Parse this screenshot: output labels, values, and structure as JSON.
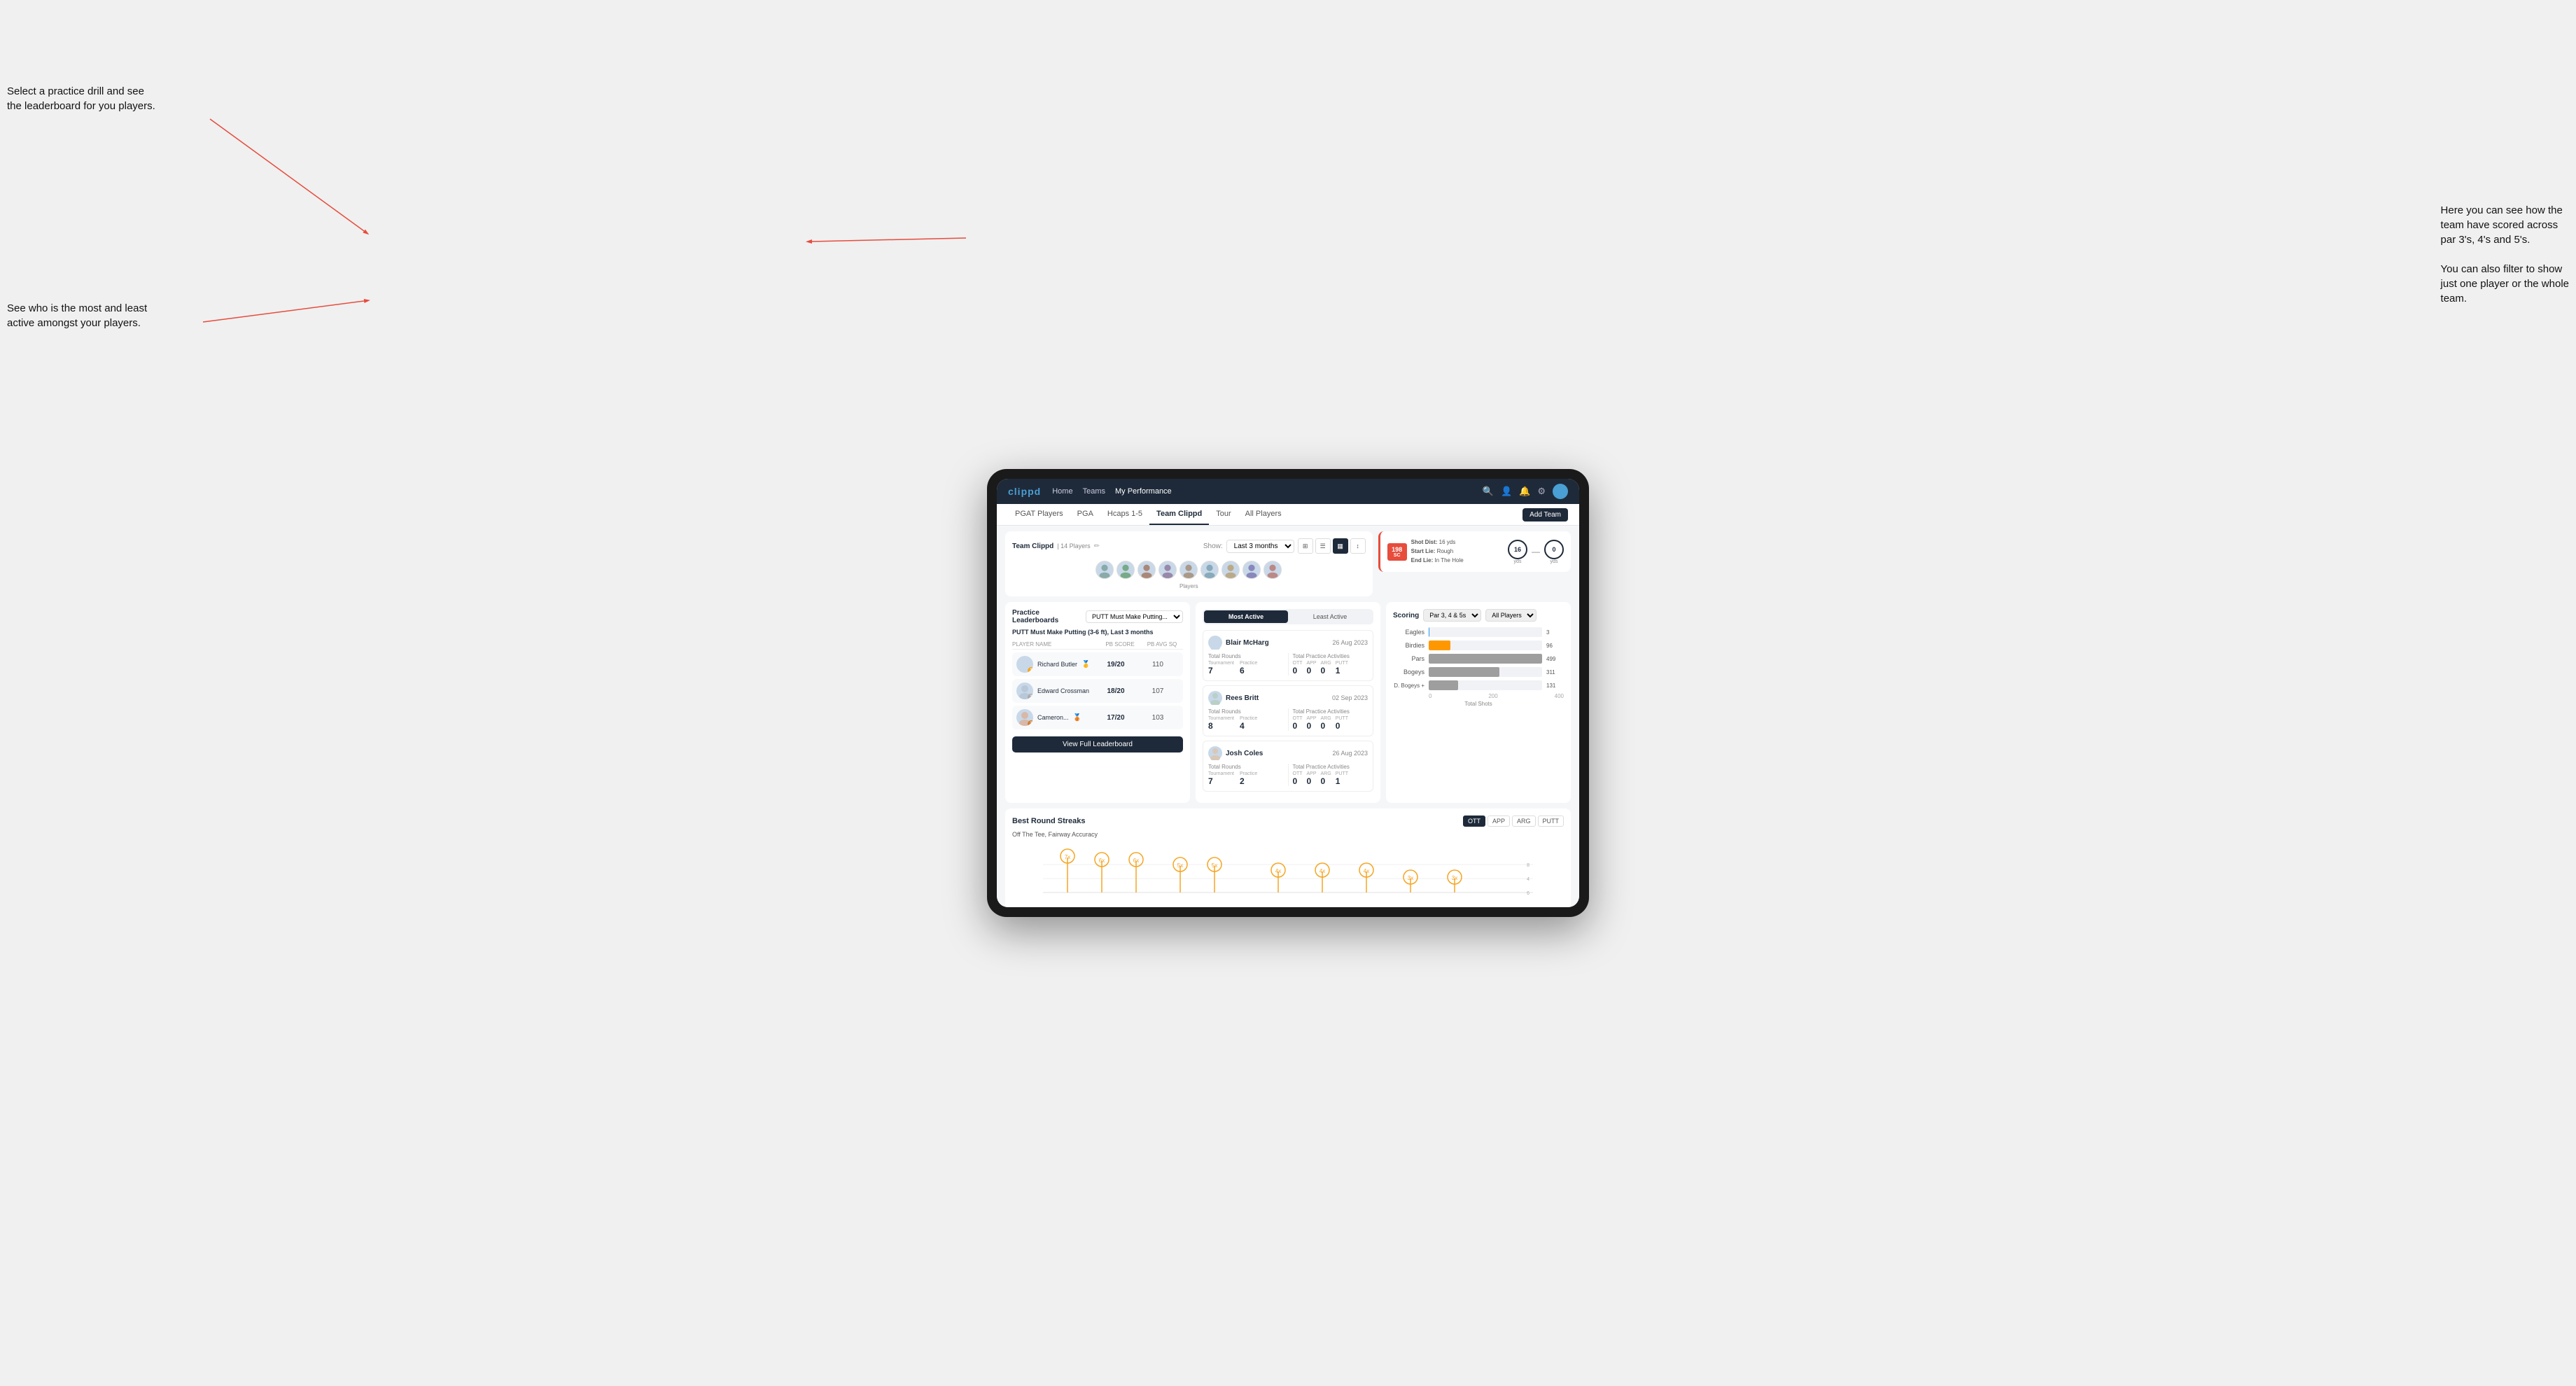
{
  "annotations": {
    "top_left": "Select a practice drill and see\nthe leaderboard for you players.",
    "bottom_left": "See who is the most and least\nactive amongst your players.",
    "top_right_line1": "Here you can see how the",
    "top_right_line2": "team have scored across",
    "top_right_line3": "par 3's, 4's and 5's.",
    "top_right_line4": "",
    "top_right_line5": "You can also filter to show",
    "top_right_line6": "just one player or the whole",
    "top_right_line7": "team."
  },
  "navbar": {
    "logo": "clippd",
    "links": [
      "Home",
      "Teams",
      "My Performance"
    ],
    "icons": [
      "search",
      "users",
      "bell",
      "settings",
      "avatar"
    ]
  },
  "subnav": {
    "links": [
      "PGAT Players",
      "PGA",
      "Hcaps 1-5",
      "Team Clippd",
      "Tour",
      "All Players"
    ],
    "active": "Team Clippd",
    "add_button": "Add Team"
  },
  "team_header": {
    "title": "Team Clippd",
    "players_count": "14 Players",
    "show_label": "Show:",
    "show_value": "Last 3 months",
    "players_label": "Players"
  },
  "shot_card": {
    "badge": "198",
    "badge_sub": "SC",
    "shot_dist_label": "Shot Dist:",
    "shot_dist_value": "16 yds",
    "start_lie_label": "Start Lie:",
    "start_lie_value": "Rough",
    "end_lie_label": "End Lie:",
    "end_lie_value": "In The Hole",
    "circle1_value": "16",
    "circle1_label": "yds",
    "circle2_value": "0",
    "circle2_label": "yds"
  },
  "practice_leaderboards": {
    "title": "Practice Leaderboards",
    "drill_select": "PUTT Must Make Putting...",
    "drill_full": "PUTT Must Make Putting (3-6 ft),",
    "drill_period": "Last 3 months",
    "col_player": "PLAYER NAME",
    "col_score": "PB SCORE",
    "col_avg": "PB AVG SQ",
    "players": [
      {
        "name": "Richard Butler",
        "score": "19/20",
        "avg": "110",
        "badge": "gold",
        "badge_num": "1"
      },
      {
        "name": "Edward Crossman",
        "score": "18/20",
        "avg": "107",
        "badge": "silver",
        "badge_num": "2"
      },
      {
        "name": "Cameron...",
        "score": "17/20",
        "avg": "103",
        "badge": "bronze",
        "badge_num": "3"
      }
    ],
    "view_full_label": "View Full Leaderboard"
  },
  "activity_panel": {
    "tabs": [
      "Most Active",
      "Least Active"
    ],
    "active_tab": "Most Active",
    "players": [
      {
        "name": "Blair McHarg",
        "date": "26 Aug 2023",
        "total_rounds_label": "Total Rounds",
        "tournament_label": "Tournament",
        "tournament_value": "7",
        "practice_label": "Practice",
        "practice_value": "6",
        "total_practice_label": "Total Practice Activities",
        "ott_label": "OTT",
        "ott_value": "0",
        "app_label": "APP",
        "app_value": "0",
        "arg_label": "ARG",
        "arg_value": "0",
        "putt_label": "PUTT",
        "putt_value": "1"
      },
      {
        "name": "Rees Britt",
        "date": "02 Sep 2023",
        "total_rounds_label": "Total Rounds",
        "tournament_label": "Tournament",
        "tournament_value": "8",
        "practice_label": "Practice",
        "practice_value": "4",
        "total_practice_label": "Total Practice Activities",
        "ott_label": "OTT",
        "ott_value": "0",
        "app_label": "APP",
        "app_value": "0",
        "arg_label": "ARG",
        "arg_value": "0",
        "putt_label": "PUTT",
        "putt_value": "0"
      },
      {
        "name": "Josh Coles",
        "date": "26 Aug 2023",
        "total_rounds_label": "Total Rounds",
        "tournament_label": "Tournament",
        "tournament_value": "7",
        "practice_label": "Practice",
        "practice_value": "2",
        "total_practice_label": "Total Practice Activities",
        "ott_label": "OTT",
        "ott_value": "0",
        "app_label": "APP",
        "app_value": "0",
        "arg_label": "ARG",
        "arg_value": "0",
        "putt_label": "PUTT",
        "putt_value": "1"
      }
    ]
  },
  "scoring": {
    "title": "Scoring",
    "filter1": "Par 3, 4 & 5s",
    "filter2": "All Players",
    "bars": [
      {
        "label": "Eagles",
        "value": 3,
        "max": 500,
        "color": "#2196f3",
        "display": "3"
      },
      {
        "label": "Birdies",
        "value": 96,
        "max": 500,
        "color": "#ff9800",
        "display": "96"
      },
      {
        "label": "Pars",
        "value": 499,
        "max": 500,
        "color": "#9e9e9e",
        "display": "499"
      },
      {
        "label": "Bogeys",
        "value": 311,
        "max": 500,
        "color": "#9e9e9e",
        "display": "311"
      },
      {
        "label": "D. Bogeys +",
        "value": 131,
        "max": 500,
        "color": "#9e9e9e",
        "display": "131"
      }
    ],
    "x_labels": [
      "0",
      "200",
      "400"
    ],
    "x_title": "Total Shots"
  },
  "streaks": {
    "title": "Best Round Streaks",
    "tabs": [
      "OTT",
      "APP",
      "ARG",
      "PUTT"
    ],
    "active_tab": "OTT",
    "subtitle": "Off The Tee, Fairway Accuracy",
    "data_points": [
      {
        "x": 0.05,
        "label": "7x"
      },
      {
        "x": 0.12,
        "label": "6x"
      },
      {
        "x": 0.19,
        "label": "6x"
      },
      {
        "x": 0.28,
        "label": "5x"
      },
      {
        "x": 0.35,
        "label": "5x"
      },
      {
        "x": 0.46,
        "label": "4x"
      },
      {
        "x": 0.55,
        "label": "4x"
      },
      {
        "x": 0.64,
        "label": "4x"
      },
      {
        "x": 0.73,
        "label": "3x"
      },
      {
        "x": 0.82,
        "label": "3x"
      }
    ]
  }
}
